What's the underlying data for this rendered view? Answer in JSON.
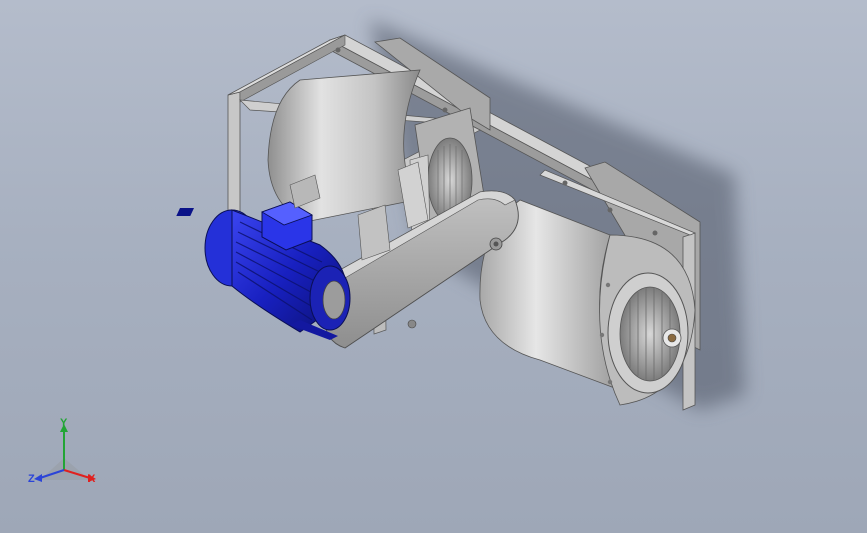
{
  "viewport": {
    "background_top": "#b4bccb",
    "background_bottom": "#9ea7b7"
  },
  "model": {
    "components": [
      "frame",
      "fan-housing-left",
      "fan-housing-right",
      "belt-guard",
      "electric-motor",
      "fan-impeller"
    ],
    "motor_color": "#1a23c9",
    "housing_color": "#c9c9c9",
    "frame_color": "#b9b9b9"
  },
  "triad": {
    "x_label": "X",
    "y_label": "Y",
    "z_label": "Z",
    "x_color": "#e0201e",
    "y_color": "#22a535",
    "z_color": "#2b44d8"
  }
}
